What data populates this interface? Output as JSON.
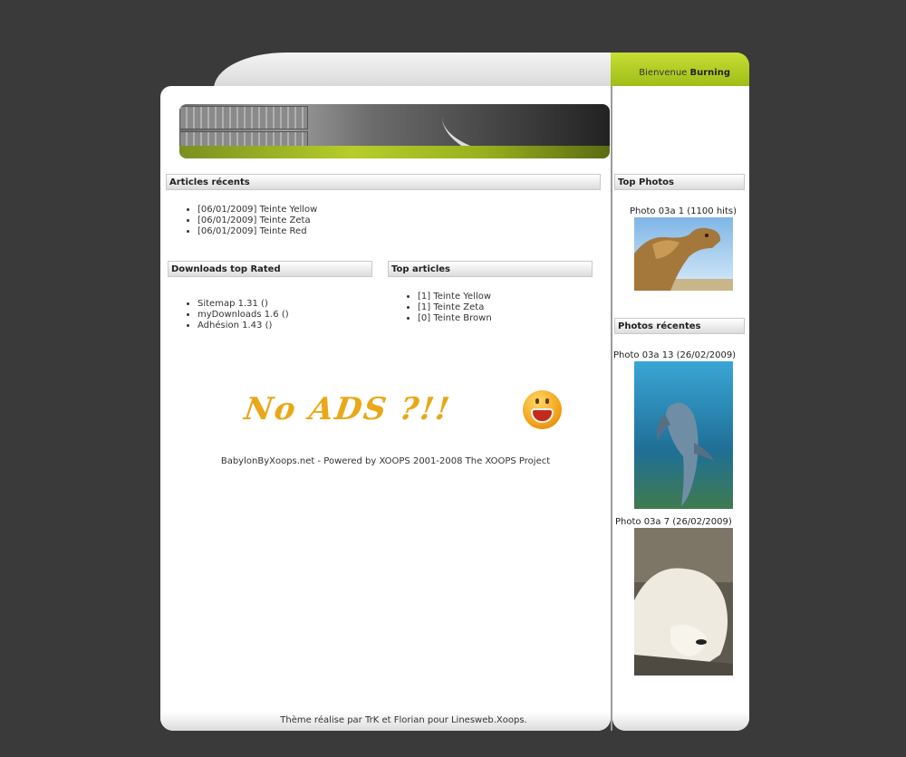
{
  "header": {
    "welcome_prefix": "Bienvenue",
    "welcome_user": "Burning"
  },
  "blocks": {
    "articles_recents": {
      "title": "Articles récents",
      "items": [
        "[06/01/2009] Teinte Yellow",
        "[06/01/2009] Teinte Zeta",
        "[06/01/2009] Teinte Red"
      ]
    },
    "downloads_top": {
      "title": "Downloads top Rated",
      "items": [
        "Sitemap 1.31 ()",
        "myDownloads 1.6 ()",
        "Adhésion 1.43 ()"
      ]
    },
    "top_articles": {
      "title": "Top articles",
      "items": [
        "[1] Teinte Yellow",
        "[1] Teinte Zeta",
        "[0] Teinte Brown"
      ]
    }
  },
  "ad": {
    "text": "No ADS ?!!"
  },
  "footer": {
    "powered": "BabylonByXoops.net - Powered by XOOPS 2001-2008 The XOOPS Project",
    "credit": "Thème réalise par TrK et Florian pour Linesweb.Xoops."
  },
  "sidebar": {
    "top_photos": {
      "title": "Top Photos",
      "caption": "Photo 03a 1 (1100 hits)"
    },
    "recent_photos": {
      "title": "Photos récentes",
      "captions": [
        "Photo 03a 13 (26/02/2009)",
        "Photo 03a 7 (26/02/2009)"
      ]
    }
  },
  "icons": [
    "camel-photo",
    "dolphin-photo",
    "polar-bear-photo",
    "shocked-smiley-icon"
  ],
  "colors": {
    "accent_lime": "#a8c520",
    "background": "#3a3a3a"
  }
}
